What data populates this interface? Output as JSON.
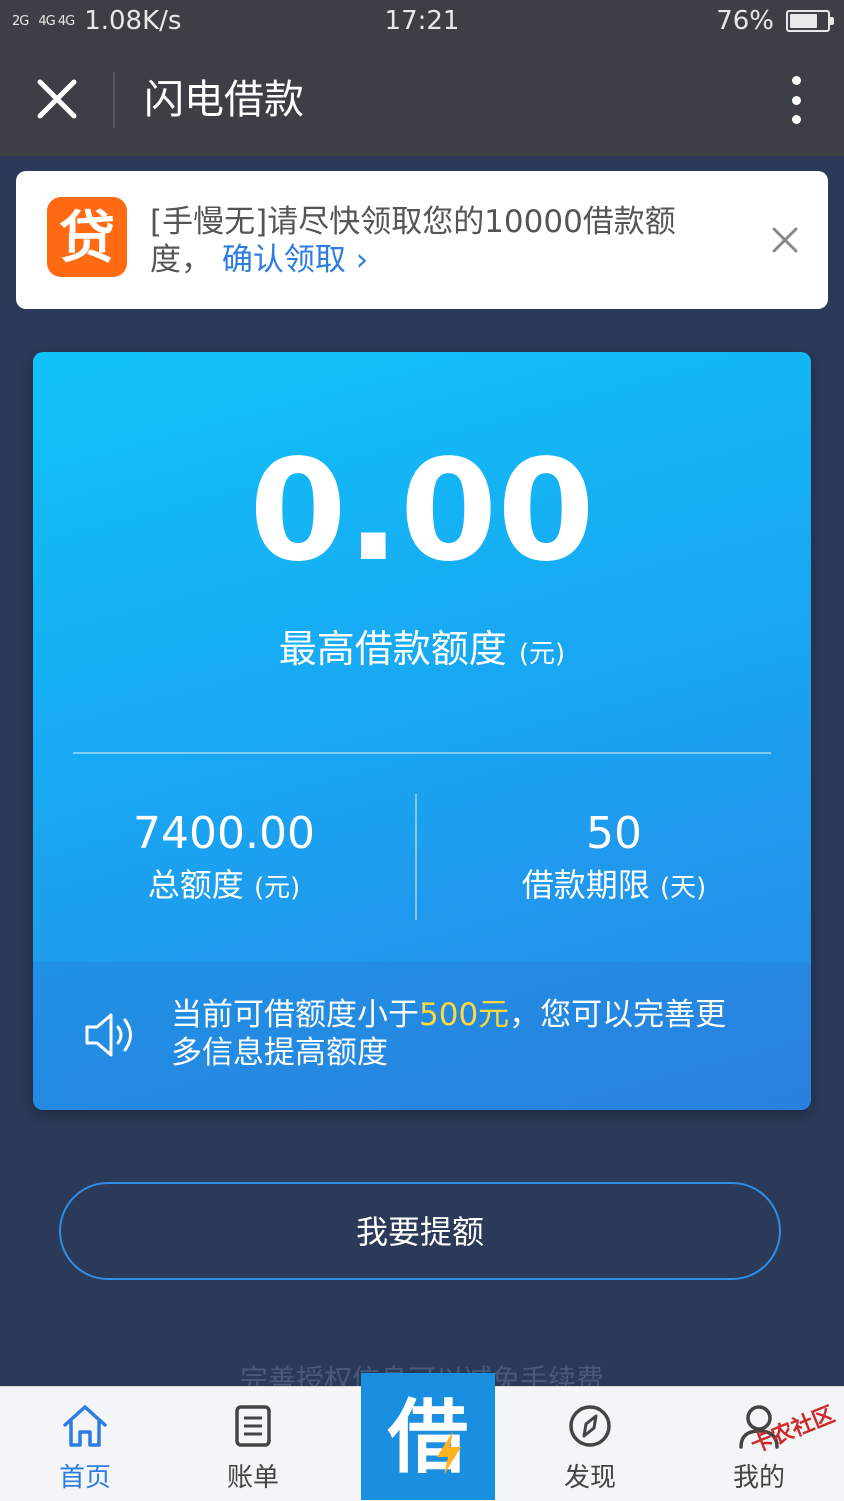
{
  "status_bar": {
    "signal_left": "2G",
    "signal_right": "4G 4G",
    "net_speed": "1.08K/s",
    "time": "17:21",
    "battery": "76%",
    "battery_level": 0.76
  },
  "title_bar": {
    "title": "闪电借款"
  },
  "notification": {
    "app_icon_char": "贷",
    "message": "[手慢无]请尽快领取您的10000借款额度，",
    "link_label": "确认领取",
    "link_chevron": "›"
  },
  "card": {
    "amount": "0.00",
    "amount_label": "最高借款额度",
    "amount_unit": "(元)",
    "total_value": "7400.00",
    "total_label": "总额度",
    "total_unit": "(元)",
    "term_value": "50",
    "term_label": "借款期限",
    "term_unit": "(天)",
    "tip_prefix": "当前可借额度小于",
    "tip_highlight": "500元",
    "tip_suffix": "，您可以完善更多信息提高额度"
  },
  "raise_button": "我要提额",
  "faded_text": "完善授权信息可以减免手续费",
  "bottom_nav": {
    "home": "首页",
    "bills": "账单",
    "borrow": "借",
    "discover": "发现",
    "mine": "我的"
  },
  "watermark": "卡农社区",
  "colors": {
    "accent": "#2f7ce0",
    "highlight": "#ffd83a",
    "background": "#2b3a58",
    "app_icon": "#ff6a13"
  }
}
